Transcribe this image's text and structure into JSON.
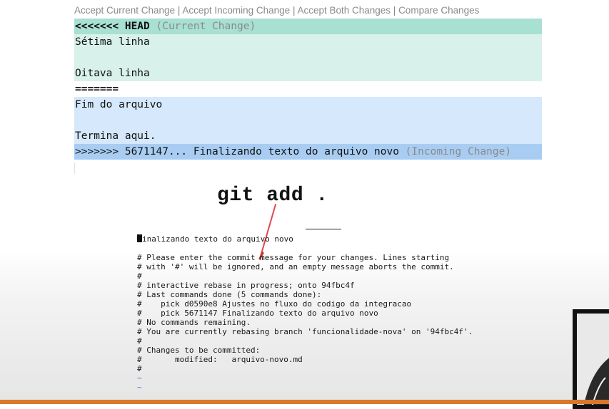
{
  "codelens": {
    "accept_current": "Accept Current Change",
    "sep": " | ",
    "accept_incoming": "Accept Incoming Change",
    "accept_both": "Accept Both Changes",
    "compare": "Compare Changes"
  },
  "conflict": {
    "head_marker": "<<<<<<< HEAD",
    "head_hint": " (Current Change)",
    "current_lines": [
      "Sétima linha",
      "",
      "Oitava linha"
    ],
    "separator": "=======",
    "incoming_lines": [
      "Fim do arquivo",
      "",
      "Termina aqui."
    ],
    "incoming_marker": ">>>>>>> 5671147... Finalizando texto do arquivo novo",
    "incoming_hint": " (Incoming Change)"
  },
  "overlay_command": "git add .",
  "terminal": {
    "first_char": "F",
    "first_rest": "inalizando texto do arquivo novo",
    "lines": [
      "",
      "# Please enter the commit message for your changes. Lines starting",
      "# with '#' will be ignored, and an empty message aborts the commit.",
      "#",
      "# interactive rebase in progress; onto 94fbc4f",
      "# Last commands done (5 commands done):",
      "#    pick d0590e8 Ajustes no fluxo do codigo da integracao",
      "#    pick 5671147 Finalizando texto do arquivo novo",
      "# No commands remaining.",
      "# You are currently rebasing branch 'funcionalidade-nova' on '94fbc4f'.",
      "#",
      "# Changes to be committed:",
      "#       modified:   arquivo-novo.md",
      "#"
    ],
    "tildes": [
      "~",
      "~"
    ]
  },
  "colors": {
    "current_header": "#a8e0d2",
    "current_body": "#d8f1ea",
    "incoming_body": "#d6e8fb",
    "incoming_header": "#a9cdf2",
    "bottom_bar": "#d9772a"
  }
}
